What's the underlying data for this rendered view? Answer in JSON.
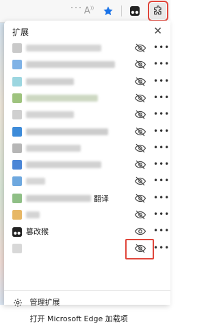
{
  "toolbar": {
    "read_aloud_label": "A",
    "extensions_icon": "puzzle-icon",
    "accent_color": "#1a73e8",
    "highlight_color": "#e0453a"
  },
  "popup": {
    "title": "扩展",
    "extensions": [
      {
        "label": "",
        "icon_color": "#c9c9c9",
        "name_color": "#d5d5d5",
        "name_width": 110
      },
      {
        "label": "",
        "icon_color": "#7fb2e6",
        "name_color": "#d0d0d0",
        "name_width": 130
      },
      {
        "label": "",
        "icon_color": "#9cd6e0",
        "name_color": "#cfcfcf",
        "name_width": 70
      },
      {
        "label": "",
        "icon_color": "#9ec37e",
        "name_color": "#cdd8c2",
        "name_width": 105
      },
      {
        "label": "",
        "icon_color": "#cfcfcf",
        "name_color": "#d3d3d3",
        "name_width": 70
      },
      {
        "label": "",
        "icon_color": "#3d8bd9",
        "name_color": "#cccccc",
        "name_width": 120
      },
      {
        "label": "",
        "icon_color": "#b6b6b6",
        "name_color": "#d3d3d3",
        "name_width": 80
      },
      {
        "label": "",
        "icon_color": "#4b86d6",
        "name_color": "#d1d1d1",
        "name_width": 110
      },
      {
        "label": "",
        "icon_color": "#6ea8df",
        "name_color": "#d6d6d6",
        "name_width": 28
      },
      {
        "label": "翻译",
        "icon_color": "#8fbf86",
        "name_color": "#cfcfcf",
        "name_width": 95
      },
      {
        "label": "",
        "icon_color": "#e7b765",
        "name_color": "#d4d4d4",
        "name_width": 20
      },
      {
        "label": "篡改猴",
        "icon_color": "#222222",
        "name_color": "",
        "name_width": 0
      },
      {
        "label": "",
        "icon_color": "#d8d8d8",
        "name_color": "#e0e0e0",
        "name_width": 0
      }
    ],
    "more_label": "•••",
    "manage_label": "管理扩展",
    "open_addons_label": "打开 Microsoft Edge 加载项"
  }
}
